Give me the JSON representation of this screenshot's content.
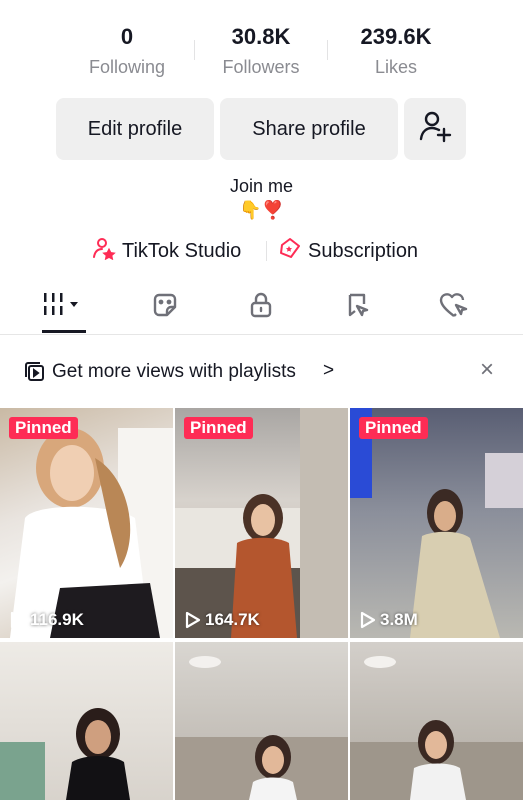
{
  "stats": [
    {
      "value": "0",
      "label": "Following"
    },
    {
      "value": "30.8K",
      "label": "Followers"
    },
    {
      "value": "239.6K",
      "label": "Likes"
    }
  ],
  "buttons": {
    "edit": "Edit profile",
    "share": "Share profile",
    "add_friend_icon": "add-person-icon"
  },
  "bio": {
    "line1": "Join me",
    "line2": "👇❣️"
  },
  "links": {
    "studio": "TikTok Studio",
    "subscription": "Subscription"
  },
  "tabs": [
    "videos-grid-icon",
    "favorites-sticker-icon",
    "lock-icon",
    "tagged-icon",
    "liked-heart-icon"
  ],
  "promo": {
    "text": "Get more views with playlists",
    "chevron": ">"
  },
  "close": "×",
  "videos": [
    {
      "pinned": "Pinned",
      "views": "116.9K"
    },
    {
      "pinned": "Pinned",
      "views": "164.7K"
    },
    {
      "pinned": "Pinned",
      "views": "3.8M"
    },
    {
      "pinned": "",
      "views": ""
    },
    {
      "pinned": "",
      "views": ""
    },
    {
      "pinned": "",
      "views": ""
    }
  ],
  "colors": {
    "accent": "#fe2c55",
    "text": "#161823",
    "muted": "#8a8b91",
    "button_bg": "#efefef"
  }
}
